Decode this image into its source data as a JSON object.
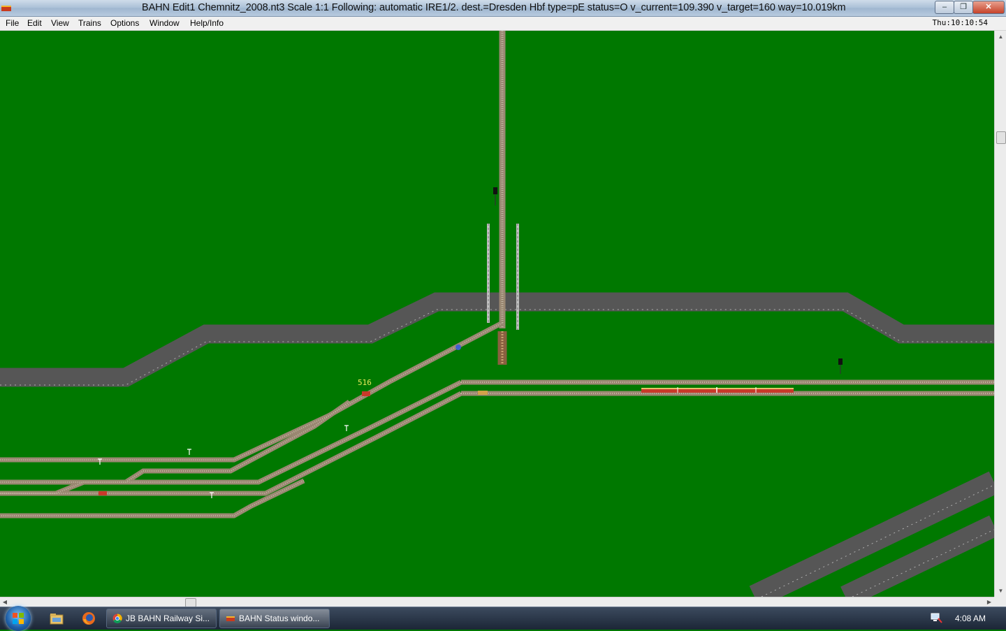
{
  "window": {
    "title": "BAHN Edit1 Chemnitz_2008.nt3 Scale 1:1 Following: automatic IRE1/2.  dest.=Dresden Hbf type=pE status=O  v_current=109.390 v_target=160 way=10.019km",
    "minimize_symbol": "–",
    "maximize_symbol": "❐",
    "close_symbol": "✕"
  },
  "menu": {
    "items": [
      "File",
      "Edit",
      "View",
      "Trains",
      "Options",
      "Window",
      "Help/Info"
    ],
    "clock": "Thu:10:10:54"
  },
  "canvas": {
    "track_label": "516",
    "background_color": "#007800",
    "road_color": "#565656",
    "track_color": "#9a8872"
  },
  "scrollbars": {
    "up_symbol": "▲",
    "down_symbol": "▼",
    "left_symbol": "◀",
    "right_symbol": "▶"
  },
  "taskbar": {
    "tasks": [
      "JB BAHN Railway Si...",
      "BAHN Status windo..."
    ],
    "time": "4:08 AM",
    "icons": [
      "windows-start-icon",
      "file-explorer-icon",
      "firefox-icon",
      "chrome-icon",
      "bahn-app-icon",
      "network-icon"
    ]
  }
}
